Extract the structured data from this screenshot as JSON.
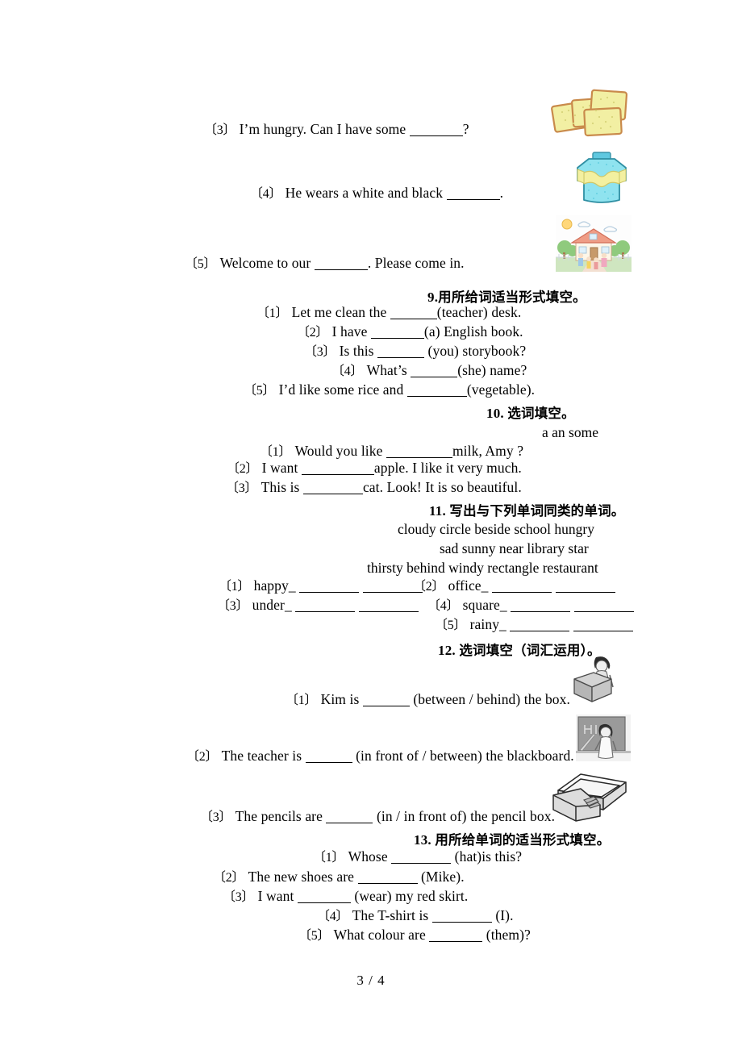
{
  "document": {
    "page_footer": "3 / 4",
    "language": "en-zh"
  },
  "section8_tail": {
    "items": [
      {
        "num": "〔3〕",
        "before": "I’m hungry. Can I have some",
        "after": "?",
        "image": "biscuits-illustration"
      },
      {
        "num": "〔4〕",
        "before": "He wears a white and black",
        "after": ".",
        "image": "sweater-illustration"
      },
      {
        "num": "〔5〕",
        "before": "Welcome to our",
        "after": ". Please come in.",
        "image": "school-house-illustration"
      }
    ]
  },
  "section9": {
    "number": "9.",
    "title": "用所给词适当形式填空。",
    "items": [
      {
        "num": "〔1〕",
        "before": "Let me clean the",
        "after": "(teacher) desk."
      },
      {
        "num": "〔2〕",
        "before": "I have",
        "after": "(a) English book."
      },
      {
        "num": "〔3〕",
        "before": "Is this",
        "after": " (you) storybook?"
      },
      {
        "num": "〔4〕",
        "before": "What’s",
        "after": "(she) name?"
      },
      {
        "num": "〔5〕",
        "before": "I’d like some rice and",
        "after": "(vegetable)."
      }
    ]
  },
  "section10": {
    "number": "10.",
    "title": "选词填空。",
    "wordbank": "a  an  some",
    "items": [
      {
        "num": "〔1〕",
        "before": "Would you like",
        "after": "milk, Amy ?"
      },
      {
        "num": "〔2〕",
        "before": "I want",
        "after": "apple. I like it very much."
      },
      {
        "num": "〔3〕",
        "before": "This is",
        "after": "cat. Look! It is so beautiful."
      }
    ]
  },
  "section11": {
    "number": "11.",
    "title": "写出与下列单词同类的单词。",
    "wordbank_lines": [
      "cloudy   circle   beside   school hungry",
      "sad   sunny near library star",
      "thirsty   behind windy   rectangle restaurant"
    ],
    "items": [
      {
        "num": "〔1〕",
        "word": "happy_"
      },
      {
        "num": "〔2〕",
        "word": "office_"
      },
      {
        "num": "〔3〕",
        "word": "under_"
      },
      {
        "num": "〔4〕",
        "word": "square_"
      },
      {
        "num": "〔5〕",
        "word": "rainy_"
      }
    ]
  },
  "section12": {
    "number": "12.",
    "title": "选词填空（词汇运用）。",
    "items": [
      {
        "num": "〔1〕",
        "before": "Kim is",
        "after": "(between / behind) the box.",
        "image": "person-behind-box-illustration"
      },
      {
        "num": "〔2〕",
        "before": "The teacher is",
        "after": "(in front of / between) the blackboard.",
        "image": "teacher-blackboard-illustration"
      },
      {
        "num": "〔3〕",
        "before": "The pencils are",
        "after": "(in / in front of) the pencil box.",
        "image": "pencil-box-illustration"
      }
    ]
  },
  "section13": {
    "number": "13.",
    "title": "用所给单词的适当形式填空。",
    "items": [
      {
        "num": "〔1〕",
        "before": "Whose",
        "after": "(hat)is this?"
      },
      {
        "num": "〔2〕",
        "before": "The new shoes are",
        "after": "(Mike)."
      },
      {
        "num": "〔3〕",
        "before": "I want",
        "after": "(wear) my red skirt."
      },
      {
        "num": "〔4〕",
        "before": "The T-shirt is",
        "after": "(I)."
      },
      {
        "num": "〔5〕",
        "before": "What colour are",
        "after": "(them)?"
      }
    ]
  },
  "colors": {
    "biscuit_fill": "#f4f0a0",
    "biscuit_edge": "#e8a96a",
    "sweater_body": "#8fe3ef",
    "sweater_band": "#f3f0a0",
    "house_roof": "#e88a72",
    "sky": "#ffffff",
    "grayscale": "#8a8a8a",
    "ink": "#000000"
  }
}
